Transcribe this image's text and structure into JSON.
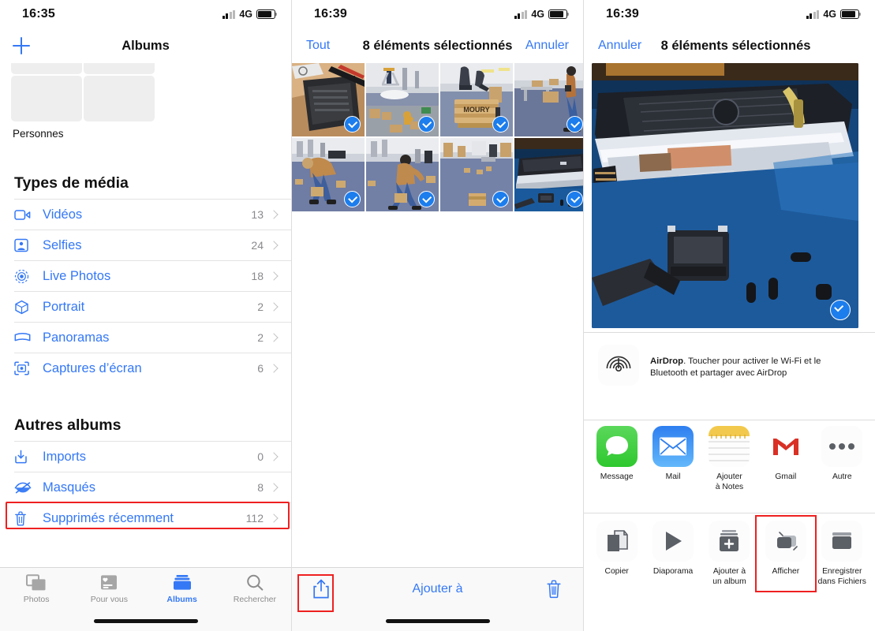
{
  "colors": {
    "accent": "#3478f6",
    "highlight": "#ef2020",
    "check_blue": "#1c7ded",
    "gray_text": "#8a8a8e"
  },
  "screen1": {
    "status": {
      "time": "16:35",
      "network": "4G"
    },
    "nav": {
      "add_label": "plus-icon",
      "title": "Albums"
    },
    "people": {
      "label": "Personnes"
    },
    "sections": [
      {
        "title": "Types de média",
        "rows": [
          {
            "icon": "video-icon",
            "label": "Vidéos",
            "count": "13"
          },
          {
            "icon": "selfie-icon",
            "label": "Selfies",
            "count": "24"
          },
          {
            "icon": "live-photo-icon",
            "label": "Live Photos",
            "count": "18"
          },
          {
            "icon": "portrait-icon",
            "label": "Portrait",
            "count": "2"
          },
          {
            "icon": "panorama-icon",
            "label": "Panoramas",
            "count": "2"
          },
          {
            "icon": "screenshot-icon",
            "label": "Captures d’écran",
            "count": "6"
          }
        ]
      },
      {
        "title": "Autres albums",
        "rows": [
          {
            "icon": "import-icon",
            "label": "Imports",
            "count": "0"
          },
          {
            "icon": "hidden-eye-icon",
            "label": "Masqués",
            "count": "8",
            "highlighted": true
          },
          {
            "icon": "trash-icon",
            "label": "Supprimés récemment",
            "count": "112"
          }
        ]
      }
    ],
    "tabs": [
      {
        "icon": "photos-icon",
        "label": "Photos",
        "active": false
      },
      {
        "icon": "for-you-icon",
        "label": "Pour vous",
        "active": false
      },
      {
        "icon": "albums-icon",
        "label": "Albums",
        "active": true
      },
      {
        "icon": "search-icon",
        "label": "Rechercher",
        "active": false
      }
    ]
  },
  "screen2": {
    "status": {
      "time": "16:39",
      "network": "4G"
    },
    "nav": {
      "left_label": "Tout",
      "title": "8 éléments sélectionnés",
      "right_label": "Annuler"
    },
    "grid": {
      "columns": 4,
      "rows": 2,
      "selected_count": 8,
      "thumbs": [
        {
          "name": "thumb-keyboard-parts",
          "selected": true
        },
        {
          "name": "thumb-office-ladder",
          "selected": true
        },
        {
          "name": "thumb-moury-crate",
          "selected": true
        },
        {
          "name": "thumb-worker-walking",
          "selected": true
        },
        {
          "name": "thumb-worker-bending",
          "selected": true
        },
        {
          "name": "thumb-worker-lifting",
          "selected": true
        },
        {
          "name": "thumb-empty-floor",
          "selected": true
        },
        {
          "name": "thumb-laptop-teardown",
          "selected": true
        }
      ]
    },
    "toolbar": {
      "share_icon": "share-icon",
      "center_label": "Ajouter à",
      "delete_icon": "trash-icon",
      "share_highlighted": true
    }
  },
  "screen3": {
    "status": {
      "time": "16:39",
      "network": "4G"
    },
    "nav": {
      "left_label": "Annuler",
      "title": "8 éléments sélectionnés"
    },
    "preview": {
      "name": "phone-repair-photo",
      "selected": true
    },
    "airdrop": {
      "icon": "airdrop-icon",
      "title": "AirDrop",
      "text": ". Toucher pour activer le Wi-Fi et le Bluetooth et partager avec AirDrop"
    },
    "apps": [
      {
        "icon": "messages-icon",
        "label": "Message"
      },
      {
        "icon": "mail-icon",
        "label": "Mail"
      },
      {
        "icon": "notes-icon",
        "label": "Ajouter\nà Notes"
      },
      {
        "icon": "gmail-icon",
        "label": "Gmail"
      },
      {
        "icon": "more-icon",
        "label": "Autre"
      }
    ],
    "actions": [
      {
        "icon": "copy-icon",
        "label": "Copier",
        "highlighted": false
      },
      {
        "icon": "slideshow-icon",
        "label": "Diaporama",
        "highlighted": false
      },
      {
        "icon": "add-album-icon",
        "label": "Ajouter à\nun album",
        "highlighted": false
      },
      {
        "icon": "unhide-icon",
        "label": "Afficher",
        "highlighted": true
      },
      {
        "icon": "save-files-icon",
        "label": "Enregistrer\ndans Fichiers",
        "highlighted": false
      }
    ]
  }
}
